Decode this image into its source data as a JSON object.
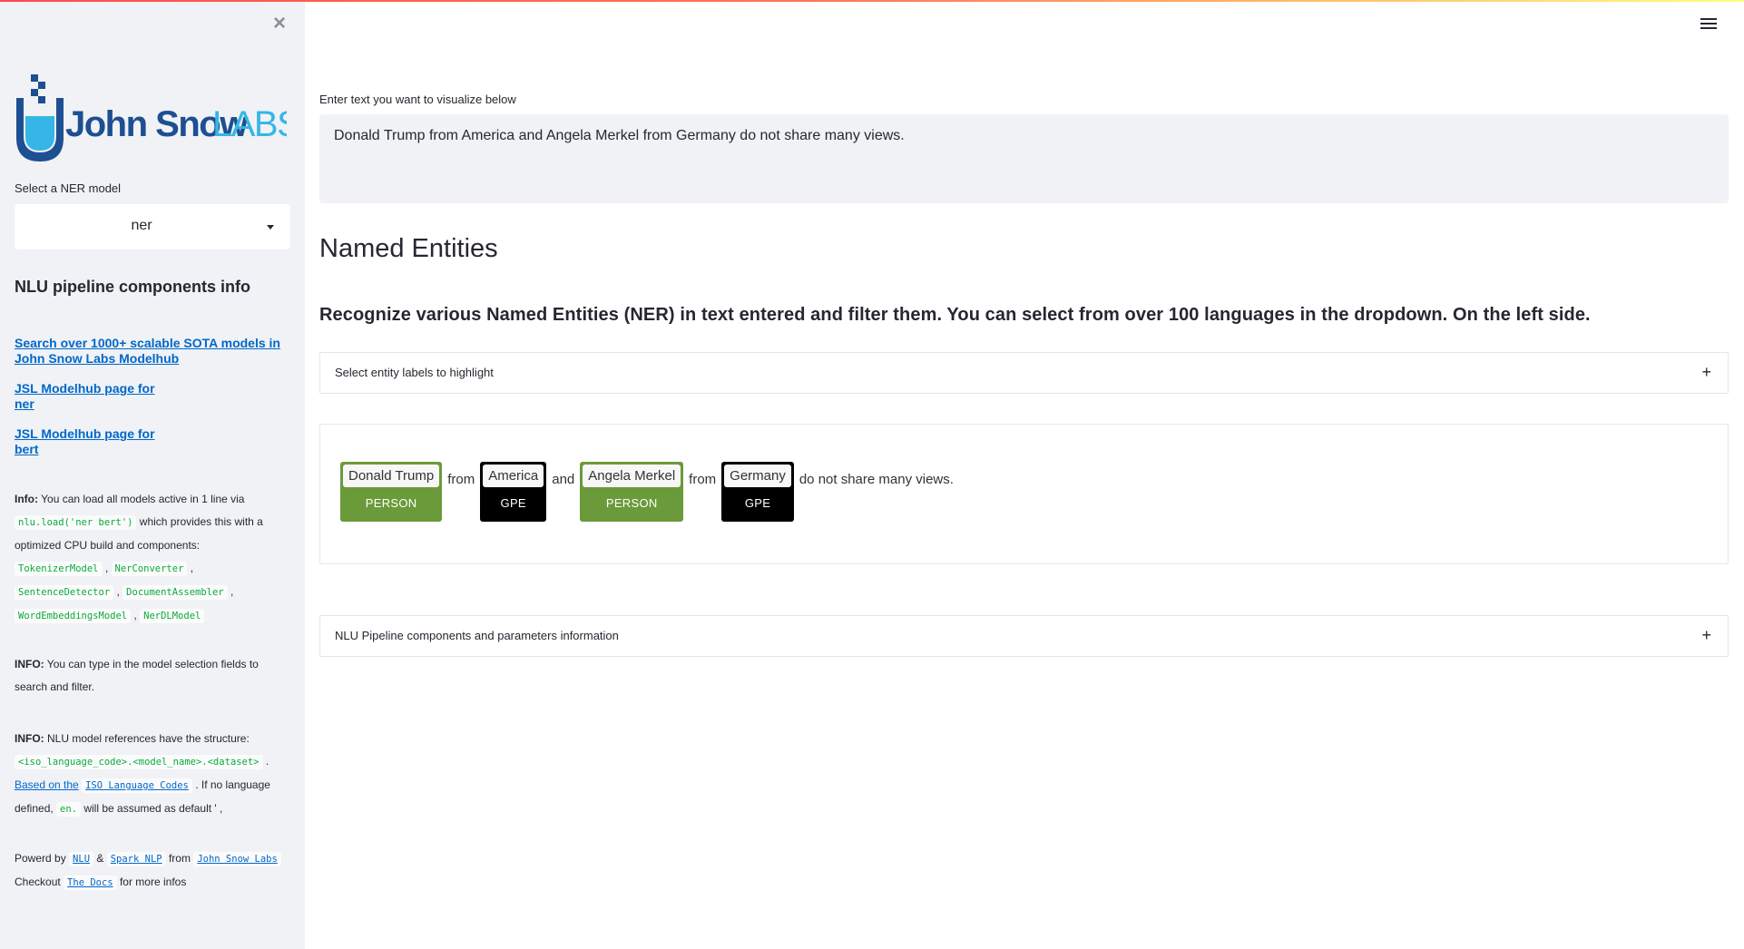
{
  "colors": {
    "accent": "#ff4b4b",
    "link": "#0068c9",
    "code": "#09ab3b",
    "person": "#6b9a3a",
    "gpe": "#000000",
    "sidebar_bg": "#f0f2f6"
  },
  "sidebar": {
    "logo_text_1": "John Snow",
    "logo_text_2": "LABS",
    "select_label": "Select a NER model",
    "select_value": "ner",
    "heading": "NLU pipeline components info",
    "link_search": "Search over 1000+ scalable SOTA models in John Snow Labs Modelhub",
    "link_ner_1": "JSL Modelhub page for",
    "link_ner_2": "ner",
    "link_bert_1": "JSL Modelhub page for",
    "link_bert_2": "bert",
    "info1": {
      "bold": "Info:",
      "t1": " You can load all models active in 1 line via ",
      "code1": "nlu.load('ner bert')",
      "t2": " which provides this with a optimized CPU build and components: ",
      "components": [
        "TokenizerModel",
        "NerConverter",
        "SentenceDetector",
        "DocumentAssembler",
        "WordEmbeddingsModel",
        "NerDLModel"
      ]
    },
    "info2": {
      "bold": "INFO:",
      "text": " You can type in the model selection fields to search and filter."
    },
    "info3": {
      "bold": "INFO:",
      "t1": " NLU model references have the structure: ",
      "code1": "<iso_language_code>.<model_name>.<dataset>",
      "t2": " . ",
      "link1": "Based on the",
      "code_link": "ISO Language Codes",
      "t3": " . If no language defined, ",
      "code2": "en.",
      "t4": " will be assumed as default ' ,"
    },
    "footer": {
      "powered": "Powerd by",
      "nlu": "NLU",
      "amp": "&",
      "spark": "Spark NLP",
      "from": "from",
      "jsl": "John Snow Labs",
      "checkout": "Checkout",
      "docs": "The Docs",
      "more": "for more infos"
    }
  },
  "main": {
    "input_label": "Enter text you want to visualize below",
    "input_value": "Donald Trump from America and Angela Merkel from Germany do not share many views.",
    "title": "Named Entities",
    "subtitle": "Recognize various Named Entities (NER) in text entered and filter them. You can select from over 100 languages in the dropdown. On the left side.",
    "expander1": "Select entity labels to highlight",
    "expander2": "NLU Pipeline components and parameters information",
    "plus": "+",
    "entities": [
      {
        "text": "Donald Trump",
        "label": "PERSON"
      },
      {
        "text": "from"
      },
      {
        "text": "America",
        "label": "GPE"
      },
      {
        "text": "and"
      },
      {
        "text": "Angela Merkel",
        "label": "PERSON"
      },
      {
        "text": "from"
      },
      {
        "text": "Germany",
        "label": "GPE"
      },
      {
        "text": "do not share many views."
      }
    ]
  }
}
